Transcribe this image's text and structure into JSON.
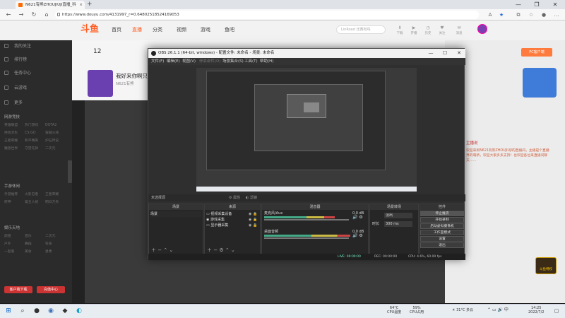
{
  "browser": {
    "tab_title": "N621有熊ZHOUJIUJI直播_科",
    "new_tab": "+",
    "url": "https://www.douyu.com/4131997_r=0.64802518524169053",
    "window_controls": [
      "—",
      "❐",
      "✕"
    ]
  },
  "site": {
    "logo": "斗鱼",
    "nav": [
      "首页",
      "直播",
      "分类",
      "视频",
      "游戏",
      "鱼吧"
    ],
    "active_nav_index": 1,
    "search_placeholder": "LinRoad 比赛有吗",
    "header_icons": [
      "下载",
      "开播",
      "历史",
      "关注",
      "消息"
    ],
    "room_count": "12",
    "room_title": "我好来你啊只",
    "room_sub": "N621有熊",
    "pc_btn": "PC客户端",
    "right_tag": "主播说",
    "right_text": "欢迎来到N621有熊ZHOUJIUJI的直播间，主播是个直播界的萌新，欢迎大家多多支持！也欢迎各位来直播间聊天……",
    "float_badge": "斗鱼特权"
  },
  "sidebar": {
    "items": [
      "我的关注",
      "排行榜",
      "任务中心",
      "云游戏",
      "更多"
    ],
    "sections": [
      {
        "title": "网游竞技",
        "items": [
          "英雄联盟",
          "热门游戏",
          "DOTA2",
          "绝地求生",
          "CS:GO",
          "穿越火线",
          "王者荣耀",
          "和平精英",
          "炉石传说",
          "魔兽世界",
          "守望先锋",
          "二次元"
        ]
      },
      {
        "title": "手游休闲",
        "items": [
          "手游推荐",
          "火影忍者",
          "王者荣耀",
          "原神",
          "第五人格",
          "明日方舟"
        ]
      },
      {
        "title": "娱乐天地",
        "items": [
          "颜值",
          "音乐",
          "二次元",
          "户外",
          "舞蹈",
          "科技",
          "一起看",
          "美食",
          "星秀"
        ]
      }
    ],
    "bottom_buttons": [
      "客户端下载",
      "充值中心"
    ]
  },
  "obs": {
    "title": "OBS 26.1.1 (64-bit, windows) - 配置文件: 未命名 - 场景: 未命名",
    "menu": [
      "文件(F)",
      "编辑(E)",
      "视图(V)",
      "停靠部件(D)",
      "场景集合(S)",
      "工具(T)",
      "帮助(H)"
    ],
    "status_left": "未选择源",
    "props_btn": "属性",
    "filters_btn": "滤镜",
    "docks": {
      "scenes": {
        "title": "场景",
        "items": [
          "场景"
        ]
      },
      "sources": {
        "title": "来源",
        "items": [
          "视频采集设备",
          "游戏采集",
          "显示器采集"
        ]
      },
      "mixer": {
        "title": "混音器",
        "channels": [
          {
            "name": "麦克风/Aux",
            "db": "0.0 dB"
          },
          {
            "name": "桌面音频",
            "db": "0.0 dB"
          }
        ]
      },
      "transitions": {
        "title": "场景转场",
        "type": "淡出",
        "duration_label": "时长",
        "duration": "300 ms"
      },
      "controls": {
        "title": "控件",
        "buttons": [
          "停止推流",
          "开始录制",
          "启动虚拟摄像机",
          "工作室模式",
          "设置",
          "退出"
        ]
      }
    },
    "footer": {
      "live": "LIVE: 00:00:00",
      "rec": "REC: 00:00:00",
      "cpu": "CPU: 4.6%, 60.00 fps"
    }
  },
  "taskbar": {
    "cpu_temp": "64°C",
    "cpu_temp_label": "CPU温度",
    "cpu_use": "59%",
    "cpu_use_label": "CPU占用",
    "weather": "31°C 多云",
    "time": "14:25",
    "date": "2022/7/2"
  },
  "colors": {
    "accent": "#ff5d23",
    "obs_bg": "#2f2f2f",
    "sidebar_bg": "#2b2b2b"
  }
}
